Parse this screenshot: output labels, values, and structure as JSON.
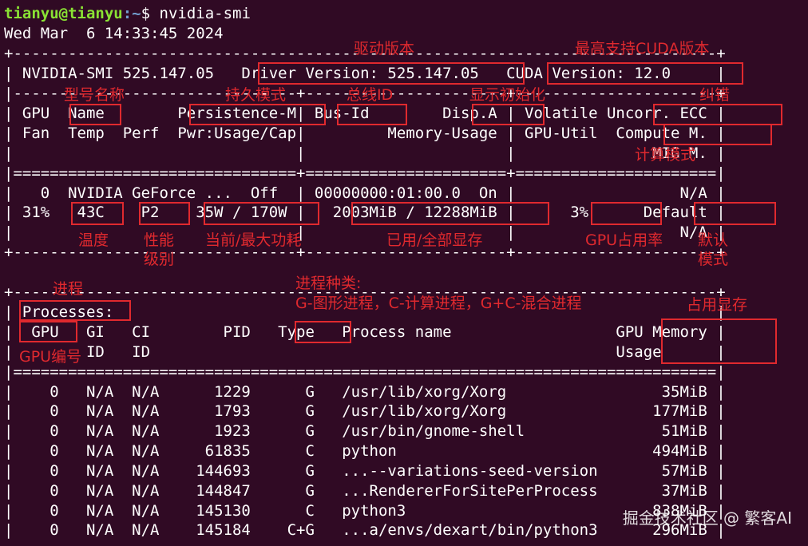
{
  "prompt": {
    "user": "tianyu@tianyu",
    "path": ":~",
    "symbol": "$ ",
    "command": "nvidia-smi"
  },
  "lines": [
    "Wed Mar  6 14:33:45 2024",
    "+-----------------------------------------------------------------------------+",
    "| NVIDIA-SMI 525.147.05   Driver Version: 525.147.05   CUDA Version: 12.0     |",
    "|-------------------------------+----------------------+----------------------+",
    "| GPU  Name        Persistence-M| Bus-Id        Disp.A | Volatile Uncorr. ECC |",
    "| Fan  Temp  Perf  Pwr:Usage/Cap|         Memory-Usage | GPU-Util  Compute M. |",
    "|                               |                      |               MIG M. |",
    "|===============================+======================+======================|",
    "|   0  NVIDIA GeForce ...  Off  | 00000000:01:00.0  On |                  N/A |",
    "| 31%   43C    P2    35W / 170W |   2003MiB / 12288MiB |      3%      Default |",
    "|                               |                      |                  N/A |",
    "+-------------------------------+----------------------+----------------------+",
    "",
    "+-----------------------------------------------------------------------------+",
    "| Processes:                                                                  |",
    "|  GPU   GI   CI        PID   Type   Process name                  GPU Memory |",
    "|        ID   ID                                                   Usage      |",
    "|=============================================================================|",
    "|    0   N/A  N/A      1229      G   /usr/lib/xorg/Xorg                 35MiB |",
    "|    0   N/A  N/A      1793      G   /usr/lib/xorg/Xorg                177MiB |",
    "|    0   N/A  N/A      1923      G   /usr/bin/gnome-shell               51MiB |",
    "|    0   N/A  N/A     61835      C   python                            494MiB |",
    "|    0   N/A  N/A    144693      G   ...--variations-seed-version       57MiB |",
    "|    0   N/A  N/A    144847      G   ...RendererForSitePerProcess       37MiB |",
    "|    0   N/A  N/A    145130      C   python3                           838MiB |",
    "|    0   N/A  N/A    145184    C+G   ...a/envs/dexart/bin/python3      296MiB |"
  ],
  "annotations": {
    "driver": "驱动版本",
    "cuda": "最高支持CUDA版本",
    "name": "型号名称",
    "persistence": "持久模式",
    "busid": "总线ID",
    "disp": "显示初始化",
    "ecc": "纠错",
    "compute": "计算模式",
    "temp": "温度",
    "perf1": "性能",
    "perf2": "级别",
    "power": "当前/最大功耗",
    "memory": "已用/全部显存",
    "gpuutil": "GPU占用率",
    "default1": "默认",
    "default2": "模式",
    "process": "进程",
    "type1": "进程种类:",
    "type2": "G-图形进程，C-计算进程，G+C-混合进程",
    "gpumem": "占用显存",
    "gpuid": "GPU编号"
  },
  "watermark": "掘金技术社区 @ 繁客AI",
  "colors": {
    "background": "#300a24",
    "annotation": "#e0292e",
    "prompt_user": "#8ae234",
    "prompt_path": "#729fcf"
  }
}
